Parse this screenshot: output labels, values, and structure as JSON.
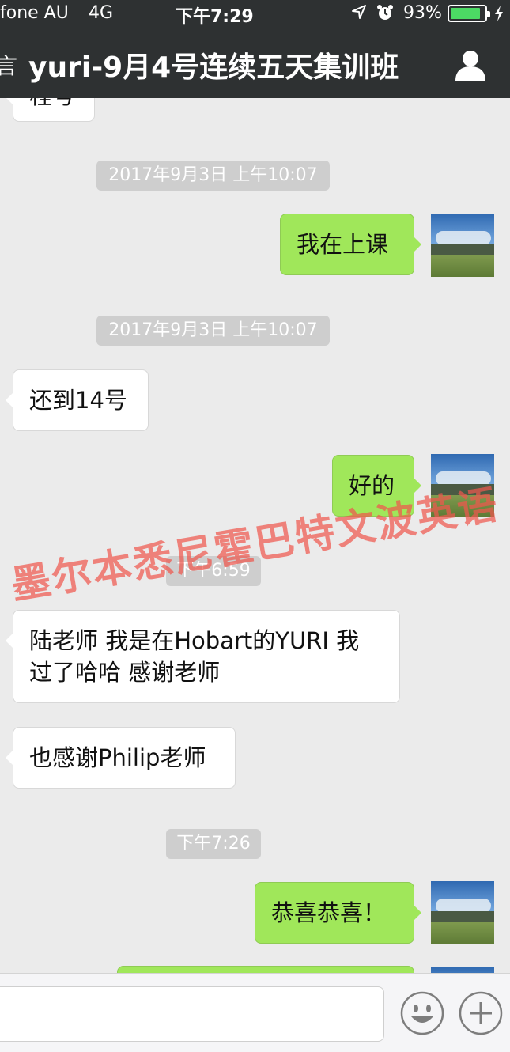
{
  "status_bar": {
    "carrier": "fone AU",
    "network": "4G",
    "time": "下午7:29",
    "battery_percent": "93%",
    "battery_level": 0.93
  },
  "nav": {
    "back_label": "言",
    "title": "yuri-9月4号连续五天集训班",
    "profile_icon": "person-icon"
  },
  "chat": {
    "partial_top_text": "程号",
    "messages": [
      {
        "kind": "timestamp",
        "text": "2017年9月3日 上午10:07"
      },
      {
        "kind": "outgoing",
        "text": "我在上课"
      },
      {
        "kind": "timestamp",
        "text": "2017年9月3日 上午10:07"
      },
      {
        "kind": "incoming",
        "text": "还到14号"
      },
      {
        "kind": "outgoing",
        "text": "好的"
      },
      {
        "kind": "timestamp",
        "text": "下午6:59"
      },
      {
        "kind": "incoming",
        "lines": [
          "陆老师 我是在Hobart的YURI 我",
          "过了哈哈 感谢老师"
        ]
      },
      {
        "kind": "incoming",
        "text": "也感谢Philip老师"
      },
      {
        "kind": "timestamp",
        "text": "下午7:26"
      },
      {
        "kind": "outgoing",
        "text": "恭喜恭喜！"
      }
    ]
  },
  "watermark": "墨尔本悉尼霍巴特文波英语",
  "input_bar": {
    "emoji_icon": "smiley-icon",
    "add_icon": "plus-icon"
  },
  "colors": {
    "header_bg": "#2e3132",
    "chat_bg": "#ebebeb",
    "outgoing_bubble": "#a0e75a",
    "incoming_bubble": "#ffffff",
    "timestamp_bg": "#cecece",
    "battery_fill": "#4cd964",
    "watermark": "#ee584e"
  }
}
